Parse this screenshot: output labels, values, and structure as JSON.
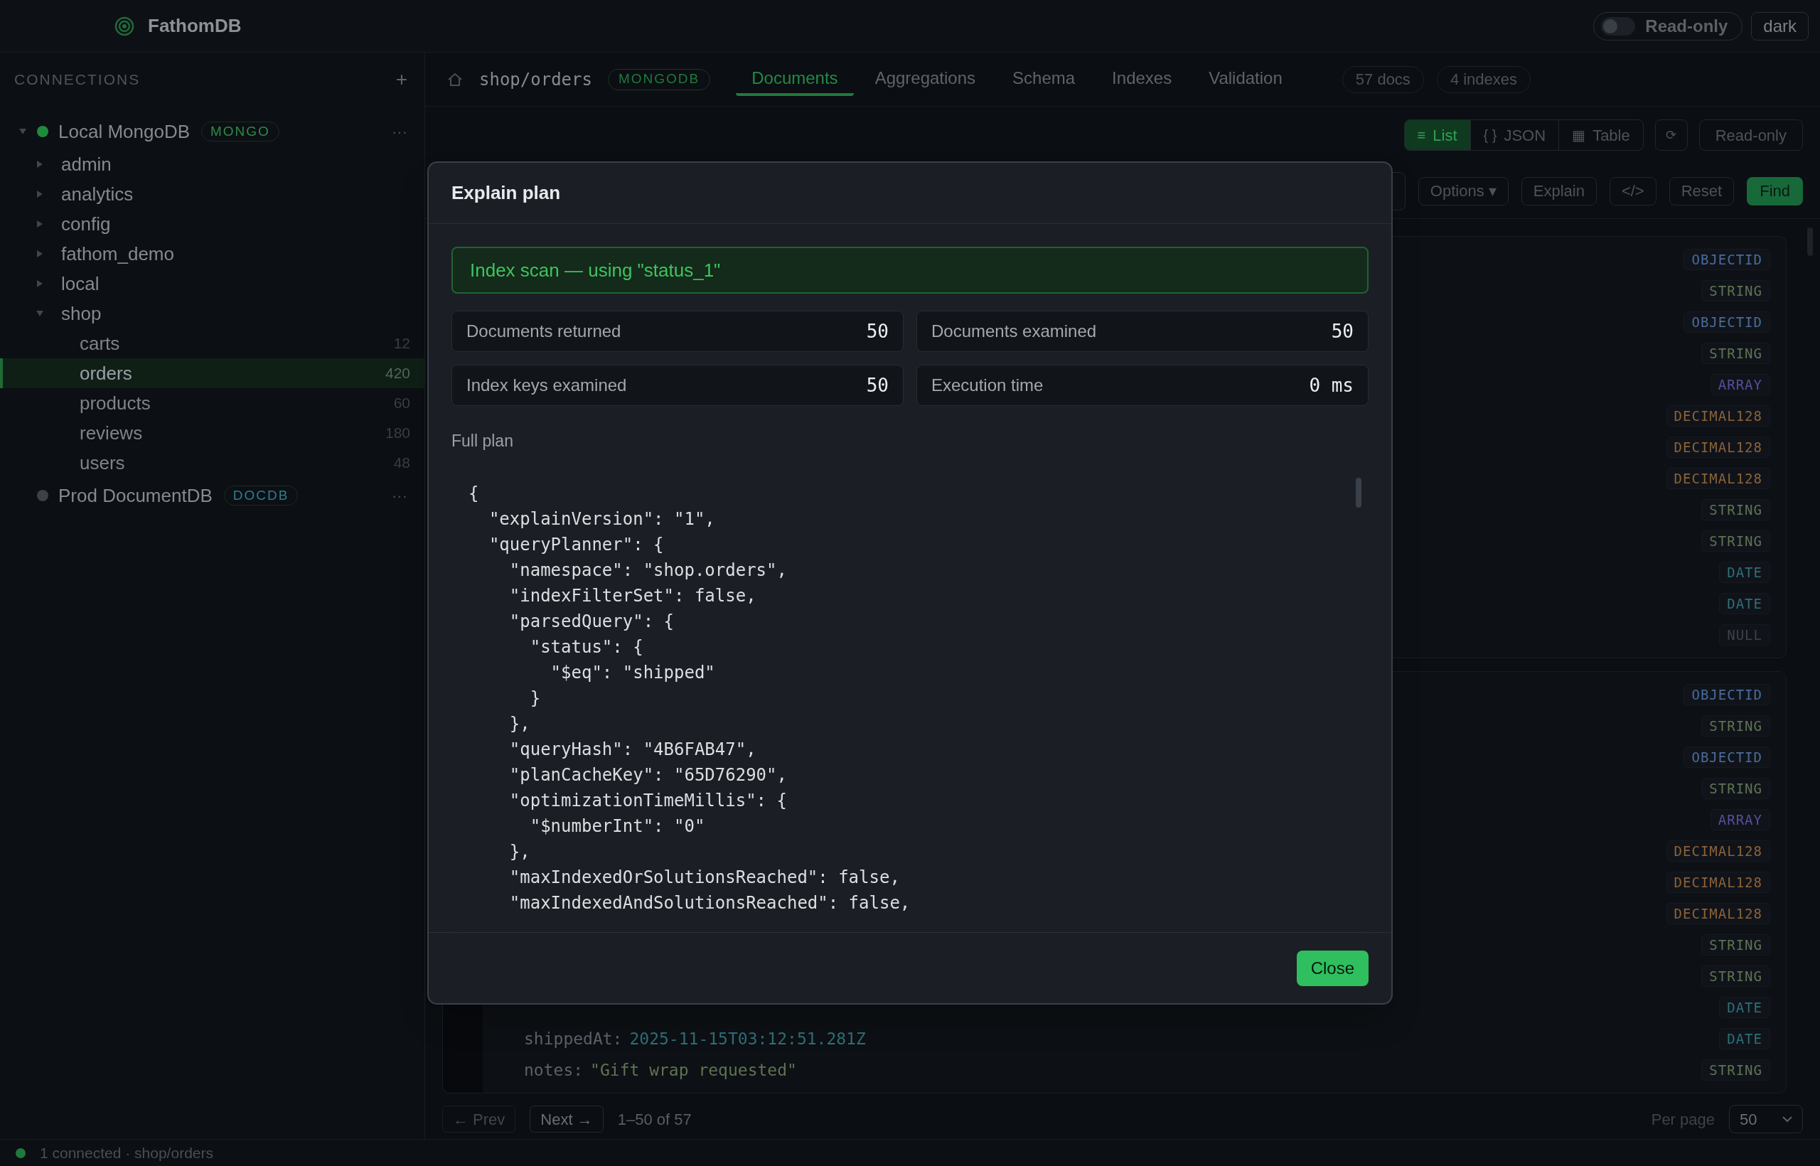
{
  "app": {
    "title": "FathomDB"
  },
  "topbar": {
    "readonly_toggle": {
      "label": "Read-only",
      "on": false
    },
    "theme_button": "dark"
  },
  "sidebar": {
    "heading": "CONNECTIONS",
    "add": "+",
    "connections": [
      {
        "name": "Local MongoDB",
        "badge": "MONGO",
        "color": "#2e8b47",
        "connected": true,
        "expanded": true,
        "more": "···",
        "children": [
          {
            "name": "admin",
            "expanded": false
          },
          {
            "name": "analytics",
            "expanded": false
          },
          {
            "name": "config",
            "expanded": false
          },
          {
            "name": "fathom_demo",
            "expanded": false
          },
          {
            "name": "local",
            "expanded": false
          },
          {
            "name": "shop",
            "expanded": true,
            "children": [
              {
                "name": "carts",
                "count": "12",
                "selected": false
              },
              {
                "name": "orders",
                "count": "420",
                "selected": true
              },
              {
                "name": "products",
                "count": "60",
                "selected": false
              },
              {
                "name": "reviews",
                "count": "180",
                "selected": false
              },
              {
                "name": "users",
                "count": "48",
                "selected": false
              }
            ]
          }
        ]
      },
      {
        "name": "Prod DocumentDB",
        "badge": "DOCDB",
        "color": "#2a7f90",
        "connected": false,
        "more": "···"
      }
    ]
  },
  "header": {
    "path": "shop/orders",
    "badge": "MONGODB",
    "tabs": [
      {
        "label": "Documents",
        "selected": true
      },
      {
        "label": "Aggregations",
        "selected": false
      },
      {
        "label": "Schema",
        "selected": false
      },
      {
        "label": "Indexes",
        "selected": false
      },
      {
        "label": "Validation",
        "selected": false
      }
    ],
    "counts": [
      "57 docs",
      "4 indexes"
    ]
  },
  "toolbar": {
    "views": [
      {
        "icon": "≡",
        "label": "List",
        "selected": true
      },
      {
        "icon": "{ }",
        "label": "JSON",
        "selected": false
      },
      {
        "icon": "▦",
        "label": "Table",
        "selected": false
      }
    ],
    "refresh": "⟳",
    "readonly": "Read-only",
    "options": "Options ▾",
    "buttons": [
      "Explain",
      "</>",
      "Reset"
    ],
    "find": "Find"
  },
  "documents": [
    {
      "fields": [
        {
          "type": "OBJECTID",
          "color": "#4a6c9c"
        },
        {
          "type": "STRING",
          "color": "#5f7352"
        },
        {
          "type": "OBJECTID",
          "color": "#4a6c9c"
        },
        {
          "type": "STRING",
          "color": "#5f7352"
        },
        {
          "type": "ARRAY",
          "color": "#5b4c9e"
        },
        {
          "type": "DECIMAL128",
          "color": "#8c6238"
        },
        {
          "type": "DECIMAL128",
          "color": "#8c6238"
        },
        {
          "type": "DECIMAL128",
          "color": "#8c6238"
        },
        {
          "type": "STRING",
          "color": "#5f7352"
        },
        {
          "type": "STRING",
          "color": "#5f7352"
        },
        {
          "type": "DATE",
          "color": "#2e6f78"
        },
        {
          "type": "DATE",
          "color": "#2e6f78"
        },
        {
          "type": "NULL",
          "color": "#3d4249"
        }
      ]
    },
    {
      "fields": [
        {
          "type": "OBJECTID",
          "color": "#4a6c9c"
        },
        {
          "type": "STRING",
          "color": "#5f7352"
        },
        {
          "type": "OBJECTID",
          "color": "#4a6c9c"
        },
        {
          "type": "STRING",
          "color": "#5f7352"
        },
        {
          "type": "ARRAY",
          "color": "#5b4c9e"
        },
        {
          "type": "DECIMAL128",
          "color": "#8c6238"
        },
        {
          "type": "DECIMAL128",
          "color": "#8c6238"
        },
        {
          "type": "DECIMAL128",
          "color": "#8c6238"
        },
        {
          "type": "STRING",
          "color": "#5f7352"
        },
        {
          "type": "STRING",
          "color": "#5f7352"
        },
        {
          "type": "DATE",
          "color": "#2e6f78"
        },
        {
          "type": "DATE",
          "color": "#2e6f78",
          "key": "shippedAt:",
          "value": "2025-11-15T03:12:51.281Z"
        },
        {
          "type": "STRING",
          "color": "#5f7352",
          "key": "notes:",
          "value": "\"Gift wrap requested\""
        }
      ]
    }
  ],
  "pagination": {
    "prev": {
      "label": "← Prev",
      "disabled": true
    },
    "next": {
      "label": "Next →",
      "disabled": false
    },
    "range": "1–50 of 57",
    "per_page_label": "Per page",
    "per_page": "50"
  },
  "status_bar": {
    "connected": true,
    "text": "1 connected · shop/orders"
  },
  "modal": {
    "title": "Explain plan",
    "banner": "Index scan — using \"status_1\"",
    "stats": [
      {
        "label": "Documents returned",
        "value": "50"
      },
      {
        "label": "Documents examined",
        "value": "50"
      },
      {
        "label": "Index keys examined",
        "value": "50"
      },
      {
        "label": "Execution time",
        "value": "0 ms"
      }
    ],
    "plan_label": "Full plan",
    "plan": "{\n  \"explainVersion\": \"1\",\n  \"queryPlanner\": {\n    \"namespace\": \"shop.orders\",\n    \"indexFilterSet\": false,\n    \"parsedQuery\": {\n      \"status\": {\n        \"$eq\": \"shipped\"\n      }\n    },\n    \"queryHash\": \"4B6FAB47\",\n    \"planCacheKey\": \"65D76290\",\n    \"optimizationTimeMillis\": {\n      \"$numberInt\": \"0\"\n    },\n    \"maxIndexedOrSolutionsReached\": false,\n    \"maxIndexedAndSolutionsReached\": false,",
    "close": "Close"
  }
}
